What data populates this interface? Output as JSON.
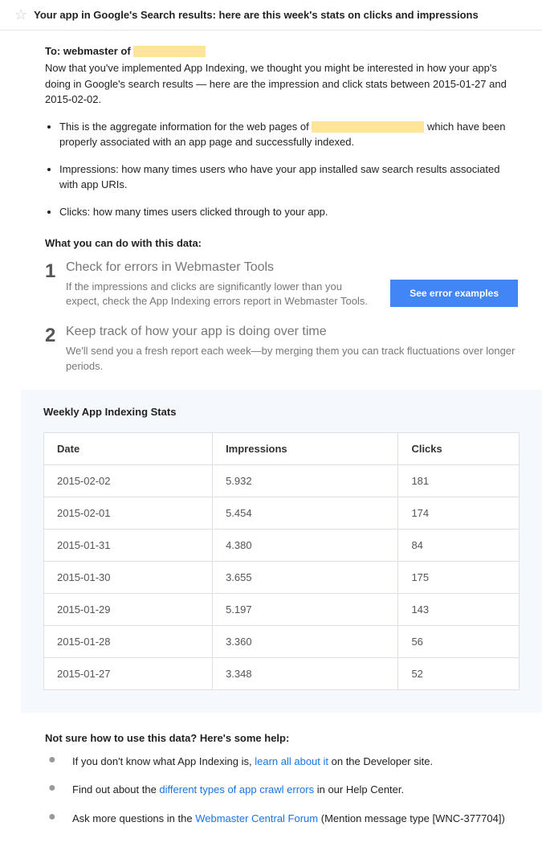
{
  "subject": "Your app in Google's Search results: here are this week's stats on clicks and impressions",
  "to_label": "To: webmaster of ",
  "intro": "Now that you've implemented App Indexing, we thought you might be interested in how your app's doing in Google's search results — here are the impression and click stats between 2015-01-27 and 2015-02-02.",
  "bullets": {
    "b1a": "This is the aggregate information for the web pages of ",
    "b1b": " which have been properly associated with an app page and successfully indexed.",
    "b2": "Impressions: how many times users who have your app installed saw search results associated with app URIs.",
    "b3": "Clicks: how many times users clicked through to your app."
  },
  "what_title": "What you can do with this data:",
  "steps": {
    "s1": {
      "num": "1",
      "title": "Check for errors in Webmaster Tools",
      "body": "If the impressions and clicks are significantly lower than you expect, check the App Indexing errors report in Webmaster Tools.",
      "button": "See error examples"
    },
    "s2": {
      "num": "2",
      "title": "Keep track of how your app is doing over time",
      "body": "We'll send you a fresh report each week—by merging them you can track fluctuations over longer periods."
    }
  },
  "stats": {
    "title": "Weekly App Indexing Stats",
    "headers": {
      "date": "Date",
      "impr": "Impressions",
      "clicks": "Clicks"
    },
    "rows": [
      {
        "date": "2015-02-02",
        "impr": "5.932",
        "clicks": "181"
      },
      {
        "date": "2015-02-01",
        "impr": "5.454",
        "clicks": "174"
      },
      {
        "date": "2015-01-31",
        "impr": "4.380",
        "clicks": "84"
      },
      {
        "date": "2015-01-30",
        "impr": "3.655",
        "clicks": "175"
      },
      {
        "date": "2015-01-29",
        "impr": "5.197",
        "clicks": "143"
      },
      {
        "date": "2015-01-28",
        "impr": "3.360",
        "clicks": "56"
      },
      {
        "date": "2015-01-27",
        "impr": "3.348",
        "clicks": "52"
      }
    ]
  },
  "help": {
    "title": "Not sure how to use this data? Here's some help:",
    "h1a": "If you don't know what App Indexing is, ",
    "h1link": "learn all about it",
    "h1b": " on the Developer site.",
    "h2a": "Find out about the ",
    "h2link": "different types of app crawl errors",
    "h2b": " in our Help Center.",
    "h3a": "Ask more questions in the ",
    "h3link": "Webmaster Central Forum",
    "h3b": " (Mention message type [WNC-377704])"
  }
}
